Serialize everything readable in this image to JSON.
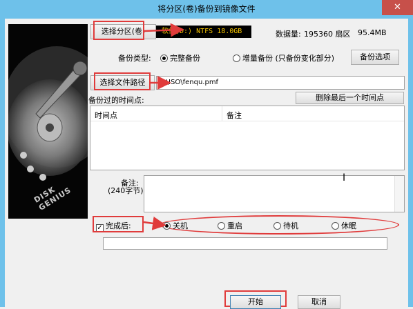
{
  "window": {
    "title": "将分区(卷)备份到镜像文件",
    "close_symbol": "✕"
  },
  "partition": {
    "select_button": "选择分区(卷)",
    "selected_info": "软件(D:) NTFS 18.0GB",
    "data_count_label": "数据量:",
    "data_count_value": "195360 扇区",
    "size_value": "95.4MB"
  },
  "backup_type": {
    "label": "备份类型:",
    "options": [
      "完整备份",
      "增量备份 (只备份变化部分)"
    ],
    "selected": 0,
    "options_button": "备份选项"
  },
  "file_path": {
    "select_button": "选择文件路径",
    "value": "U:\\ISO\\fenqu.pmf"
  },
  "timepoints": {
    "label": "备份过的时间点:",
    "delete_button": "删除最后一个时间点",
    "columns": [
      "时间点",
      "备注"
    ],
    "rows": []
  },
  "note": {
    "label": "备注:",
    "sublabel": "(240字节)",
    "value": ""
  },
  "completion": {
    "checkbox_label": "完成后:",
    "checked": true,
    "options": [
      "关机",
      "重启",
      "待机",
      "休眠"
    ],
    "selected": 0
  },
  "progress": {
    "value": 0
  },
  "actions": {
    "start": "开始",
    "cancel": "取消"
  },
  "colors": {
    "titlebar": "#6ec1ea",
    "annotation_red": "#e03b3b",
    "close": "#c7504a"
  },
  "art": {
    "brand": "DISK GENIUS"
  }
}
